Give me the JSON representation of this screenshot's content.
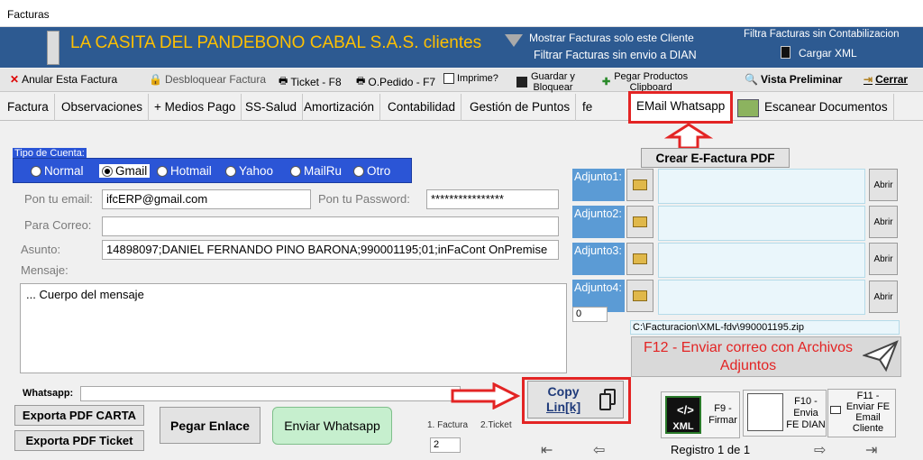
{
  "window": {
    "title": "Facturas"
  },
  "banner": {
    "company": "LA CASITA DEL PANDEBONO CABAL S.A.S. clientes",
    "show_only_client": "Mostrar Facturas solo este Cliente",
    "filter_no_dian": "Filtrar Facturas sin envio a DIAN",
    "filter_no_accounting": "Filtra Facturas sin Contabilizacion",
    "load_xml": "Cargar XML"
  },
  "toolbar": {
    "cancel": "Anular Esta Factura",
    "unlock": "Desbloquear Factura",
    "ticket": "Ticket - F8",
    "order": "O.Pedido - F7",
    "print_q": "Imprime?",
    "save_line1": "Guardar y",
    "save_line2": "Bloquear",
    "paste_line1": "Pegar Productos",
    "paste_line2": "Clipboard",
    "preview": "Vista Preliminar",
    "close": "Cerrar"
  },
  "tabs": [
    "Factura",
    "Observaciones",
    "+ Medios Pago",
    "SS-Salud",
    "Amortización",
    "Contabilidad",
    "Gestión de Puntos",
    "fe",
    "EMail Whatsapp",
    "Escanear Documentos"
  ],
  "account": {
    "legend": "Tipo de Cuenta:",
    "options": [
      "Normal",
      "Gmail",
      "Hotmail",
      "Yahoo",
      "MailRu",
      "Otro"
    ],
    "selected": "Gmail"
  },
  "form": {
    "email_label": "Pon tu email:",
    "email_value": "ifcERP@gmail.com",
    "password_label": "Pon tu Password:",
    "password_value": "****************",
    "to_label": "Para Correo:",
    "to_value": "",
    "subject_label": "Asunto:",
    "subject_value": "14898097;DANIEL FERNANDO PINO BARONA;990001195;01;inFaCont OnPremise",
    "message_label": "Mensaje:",
    "message_value": "... Cuerpo del mensaje",
    "whatsapp_label": "Whatsapp:",
    "whatsapp_value": ""
  },
  "attachments": {
    "create_pdf": "Crear E-Factura PDF",
    "labels": [
      "Adjunto1:",
      "Adjunto2:",
      "Adjunto3:",
      "Adjunto4:"
    ],
    "open": "Abrir",
    "count": "0",
    "path": "C:\\Facturacion\\XML-fdv\\990001195.zip",
    "send_f12_line1": "F12 - Enviar correo con Archivos",
    "send_f12_line2": "Adjuntos"
  },
  "buttons": {
    "export_carta": "Exporta PDF CARTA",
    "export_ticket": "Exporta PDF Ticket",
    "paste_link": "Pegar Enlace",
    "send_whatsapp": "Enviar Whatsapp",
    "copy_line1": "Copy",
    "copy_line2": "Lin[k]"
  },
  "radio_small": {
    "opt1": "1. Factura",
    "opt2": "2.Ticket",
    "value": "2"
  },
  "actions": {
    "f9_line1": "F9 -",
    "f9_line2": "Firmar",
    "xml_label": "XML",
    "f10_line1": "F10 -",
    "f10_line2": "Envia",
    "f10_line3": "FE DIAN",
    "f11_line1": "F11 -",
    "f11_line2": "Enviar FE",
    "f11_line3": "Email",
    "f11_line4": "Cliente"
  },
  "record": {
    "text": "Registro 1 de 1"
  },
  "colors": {
    "banner": "#2d5a91",
    "accent_red": "#e32424",
    "adjunto_blue": "#5b9bd5",
    "f12_text": "#e32424",
    "radio_panel": "#2b55d6"
  }
}
